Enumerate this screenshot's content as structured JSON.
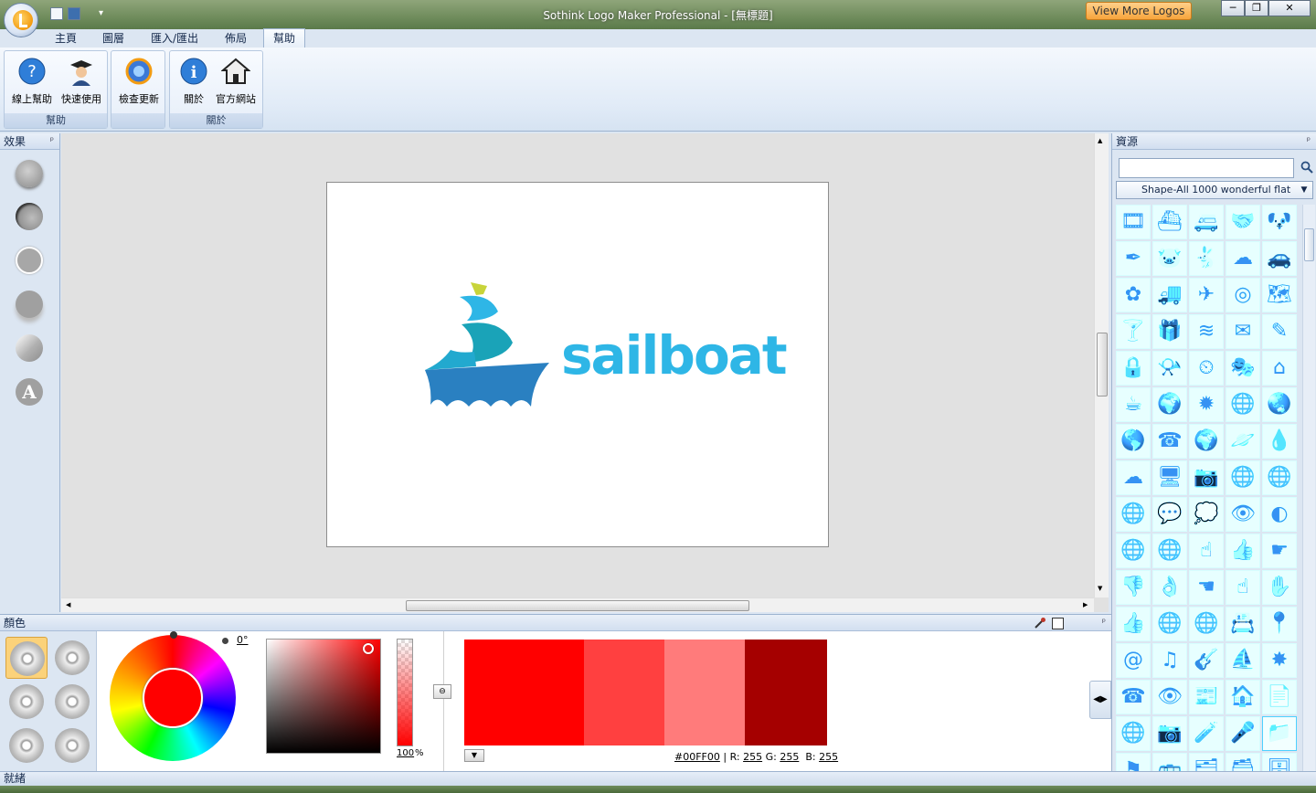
{
  "window": {
    "title": "Sothink Logo Maker Professional - [無標題]",
    "view_more": "View More Logos",
    "min": "─",
    "restore": "❐",
    "close": "✕"
  },
  "tabs": [
    {
      "label": "主頁"
    },
    {
      "label": "圖層"
    },
    {
      "label": "匯入/匯出"
    },
    {
      "label": "佈局"
    },
    {
      "label": "幫助",
      "active": true
    }
  ],
  "ribbon": {
    "groups": [
      {
        "label": "幫助",
        "buttons": [
          {
            "label": "線上幫助",
            "icon": "help-icon"
          },
          {
            "label": "快速使用",
            "icon": "graduate-icon"
          }
        ]
      },
      {
        "label": "",
        "buttons": [
          {
            "label": "檢查更新",
            "icon": "update-icon"
          }
        ]
      },
      {
        "label": "關於",
        "buttons": [
          {
            "label": "關於",
            "icon": "info-icon"
          },
          {
            "label": "官方網站",
            "icon": "home-icon"
          }
        ]
      }
    ]
  },
  "effects_panel": {
    "title": "效果",
    "pin": "ᵖ"
  },
  "canvas": {
    "logo_text": "sailboat"
  },
  "resources_panel": {
    "title": "資源",
    "pin": "ᵖ",
    "search_placeholder": "",
    "selected_category": "Shape-All 1000 wonderful flat"
  },
  "color_panel": {
    "title": "顏色",
    "angle": "0°",
    "opacity": "100",
    "opacity_unit": "%",
    "hex": "#00FF00",
    "r_label": "R:",
    "r": "255",
    "g_label": "G:",
    "g": "255",
    "b_label": "B:",
    "b": "255",
    "swatches": [
      "#ff0000",
      "#ff4040",
      "#ff7b7b",
      "#a50000"
    ]
  },
  "status": {
    "text": "就緒"
  },
  "colors": {
    "accent": "#2e78c4",
    "logo_blue": "#2eb6e6",
    "logo_teal": "#1aa3b8",
    "logo_navy": "#2a80c1",
    "logo_yellow": "#c8d43a"
  }
}
